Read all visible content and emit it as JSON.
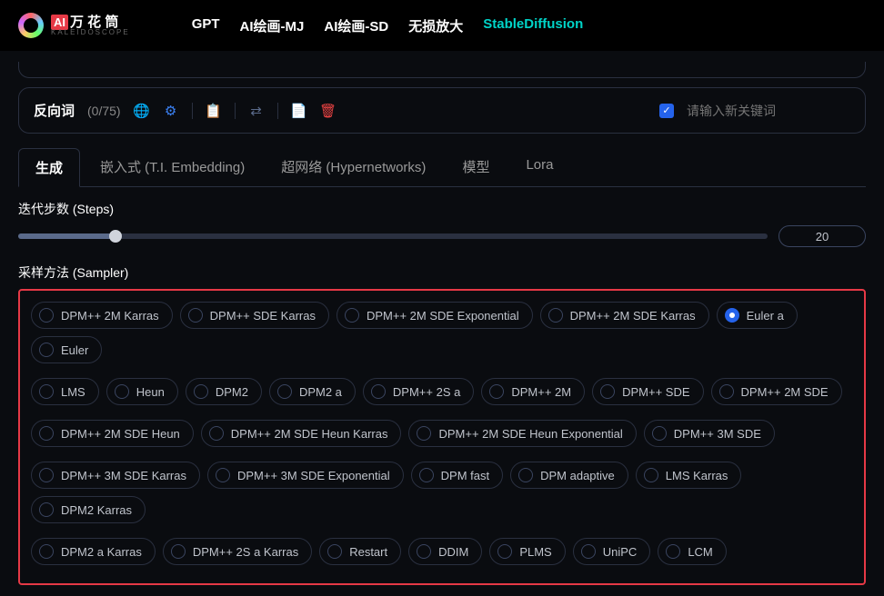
{
  "logo": {
    "ai": "AI",
    "cn": "万 花 筒",
    "en": "KALEIDOSCOPE"
  },
  "nav": {
    "gpt": "GPT",
    "mj": "AI绘画-MJ",
    "sd": "AI绘画-SD",
    "upscale": "无损放大",
    "stable": "StableDiffusion"
  },
  "neg": {
    "label": "反向词",
    "count": "(0/75)",
    "placeholder": "请输入新关键词"
  },
  "tabs": {
    "gen": "生成",
    "embed": "嵌入式 (T.I. Embedding)",
    "hyper": "超网络 (Hypernetworks)",
    "model": "模型",
    "lora": "Lora"
  },
  "steps": {
    "title": "迭代步数 (Steps)",
    "value": "20"
  },
  "sampler": {
    "title": "采样方法 (Sampler)",
    "selected": "Euler a",
    "rows": [
      [
        "DPM++ 2M Karras",
        "DPM++ SDE Karras",
        "DPM++ 2M SDE Exponential",
        "DPM++ 2M SDE Karras",
        "Euler a",
        "Euler"
      ],
      [
        "LMS",
        "Heun",
        "DPM2",
        "DPM2 a",
        "DPM++ 2S a",
        "DPM++ 2M",
        "DPM++ SDE",
        "DPM++ 2M SDE"
      ],
      [
        "DPM++ 2M SDE Heun",
        "DPM++ 2M SDE Heun Karras",
        "DPM++ 2M SDE Heun Exponential",
        "DPM++ 3M SDE"
      ],
      [
        "DPM++ 3M SDE Karras",
        "DPM++ 3M SDE Exponential",
        "DPM fast",
        "DPM adaptive",
        "LMS Karras",
        "DPM2 Karras"
      ],
      [
        "DPM2 a Karras",
        "DPM++ 2S a Karras",
        "Restart",
        "DDIM",
        "PLMS",
        "UniPC",
        "LCM"
      ]
    ]
  }
}
